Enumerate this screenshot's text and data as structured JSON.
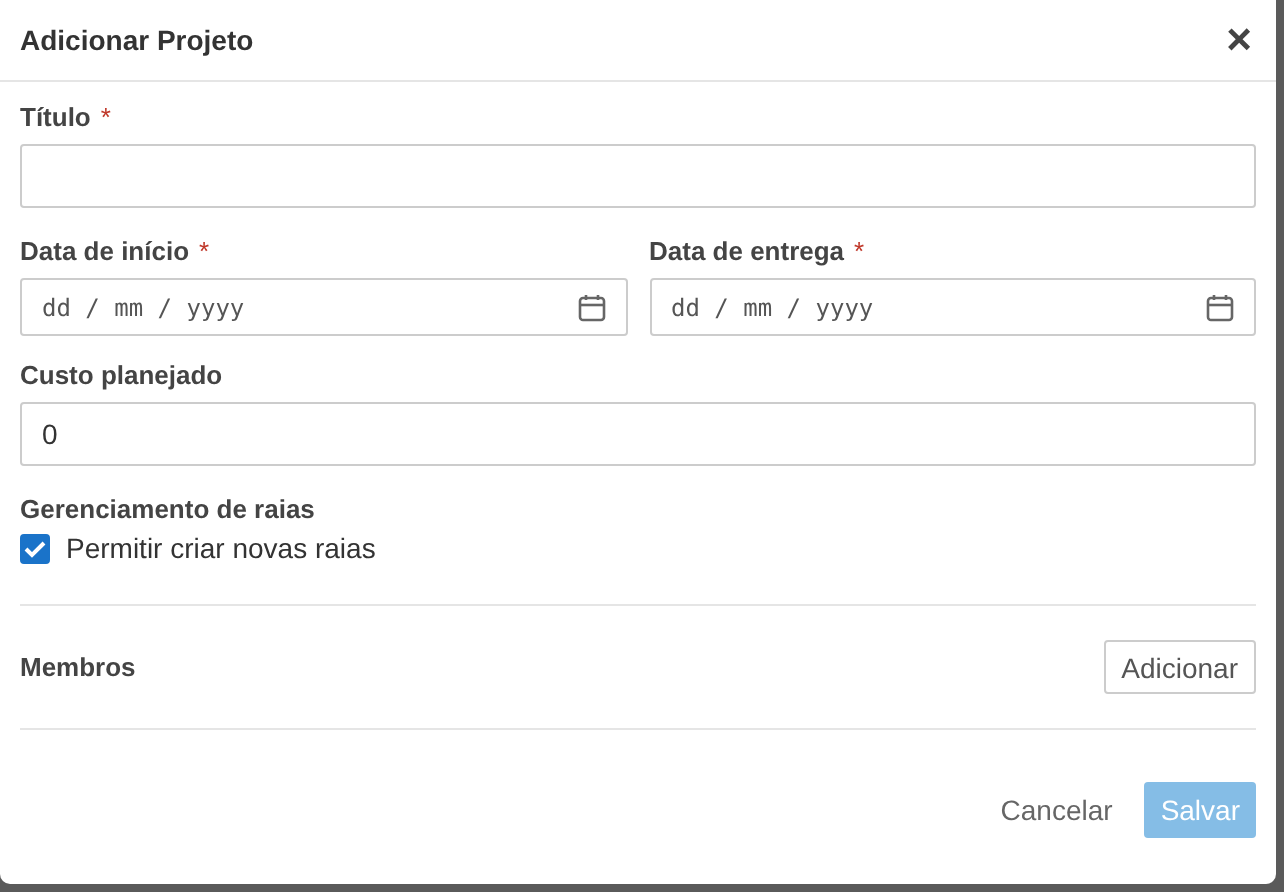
{
  "dialog": {
    "title": "Adicionar Projeto",
    "close": "×"
  },
  "fields": [
    {
      "kind": "text",
      "label": "Título",
      "required_mark": "*"
    },
    {
      "kind": "date",
      "label": "Data de início",
      "required_mark": "*",
      "placeholder": "dd / mm / yyyy"
    },
    {
      "kind": "date",
      "label": "Data de entrega",
      "required_mark": "*",
      "placeholder": "dd / mm / yyyy"
    },
    {
      "kind": "text",
      "label": "Custo planejado",
      "value": "0"
    }
  ],
  "lanes": {
    "label": "Gerenciamento de raias",
    "option": {
      "label": "Permitir criar novas raias",
      "checked": true
    }
  },
  "members": {
    "label": "Membros",
    "button": "Adicionar"
  },
  "footer": [
    {
      "label": "Cancelar",
      "kind": "link",
      "disabled": false
    },
    {
      "label": "Salvar",
      "kind": "primary",
      "disabled": true
    }
  ]
}
